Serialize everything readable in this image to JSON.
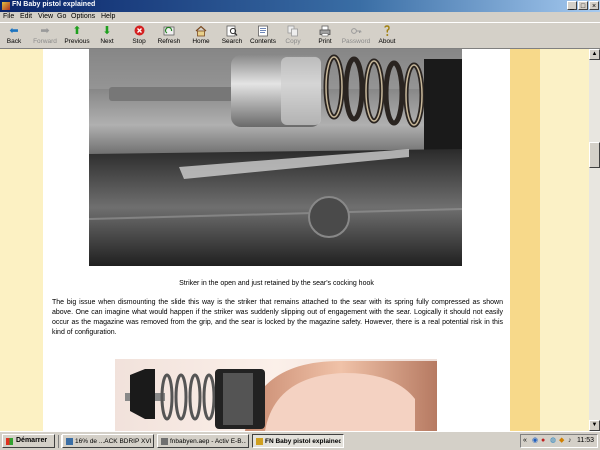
{
  "window": {
    "title": "FN Baby pistol explained"
  },
  "menu": [
    "File",
    "Edit",
    "View",
    "Go",
    "Options",
    "Help"
  ],
  "toolbar": [
    {
      "label": "Back",
      "icon": "back-arrow-icon",
      "enabled": true
    },
    {
      "label": "Forward",
      "icon": "forward-arrow-icon",
      "enabled": false
    },
    {
      "label": "Previous",
      "icon": "up-arrow-icon",
      "enabled": true
    },
    {
      "label": "Next",
      "icon": "down-arrow-icon",
      "enabled": true
    },
    {
      "label": "Stop",
      "icon": "stop-icon",
      "enabled": true
    },
    {
      "label": "Refresh",
      "icon": "refresh-icon",
      "enabled": true
    },
    {
      "label": "Home",
      "icon": "home-icon",
      "enabled": true
    },
    {
      "label": "Search",
      "icon": "search-icon",
      "enabled": true
    },
    {
      "label": "Contents",
      "icon": "contents-icon",
      "enabled": true
    },
    {
      "label": "Copy",
      "icon": "copy-icon",
      "enabled": false
    },
    {
      "label": "Print",
      "icon": "print-icon",
      "enabled": true
    },
    {
      "label": "Password",
      "icon": "password-icon",
      "enabled": false
    },
    {
      "label": "About",
      "icon": "about-icon",
      "enabled": true
    }
  ],
  "page": {
    "caption": "Striker in the open and just retained by the sear's cocking hook",
    "paragraph": "The big issue when dismounting the slide this way is the striker that remains attached to the sear with its spring fully compressed as shown above. One can imagine what would happen if the striker was suddenly slipping out of engagement with the sear. Logically it should not easily occur as the magazine was removed from the grip, and the sear is locked by the magazine safety. However, there is a real potential risk in this kind of configuration."
  },
  "taskbar": {
    "start_label": "Démarrer",
    "tasks": [
      {
        "label": "16% de ...ACK BDRIP XVI...",
        "active": false
      },
      {
        "label": "fnbabyen.aep - Activ E-B...",
        "active": false
      },
      {
        "label": "FN Baby pistol explained",
        "active": true
      }
    ],
    "tray_chevron": "«",
    "clock": "11:53"
  },
  "colors": {
    "titlebar": "#0a246a",
    "page_bg": "#ffffff",
    "left_margin": "#fcf1c3",
    "right_band": "#f7d98a"
  }
}
